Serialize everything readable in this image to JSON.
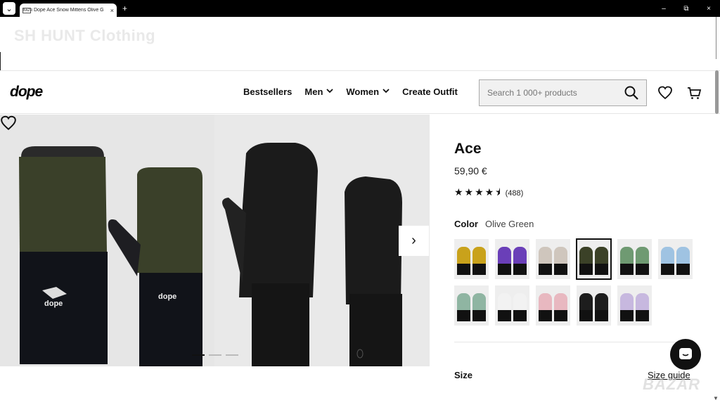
{
  "browser": {
    "tab_title": "Dope Ace Snow Mittens Olive G",
    "favicon_text": "BAZR",
    "new_tab": "+",
    "close_tab": "×",
    "minimize": "–",
    "maximize": "⧉",
    "close": "×"
  },
  "banner": {
    "store_name": "SH HUNT Clothing"
  },
  "header": {
    "logo": "dope",
    "nav": [
      {
        "label": "Bestsellers",
        "has_dropdown": false
      },
      {
        "label": "Men",
        "has_dropdown": true
      },
      {
        "label": "Women",
        "has_dropdown": true
      },
      {
        "label": "Create Outfit",
        "has_dropdown": false
      }
    ],
    "search_placeholder": "Search 1 000+ products",
    "icons": [
      "search-icon",
      "heart-icon",
      "cart-icon"
    ]
  },
  "gallery": {
    "image_count": 3,
    "active_index": 0,
    "next_icon": "›"
  },
  "product": {
    "name": "Ace",
    "price": "59,90 €",
    "rating_value": 4.5,
    "rating_stars": "★★★★⯨",
    "review_count": "(488)",
    "color_label": "Color",
    "color_value": "Olive Green",
    "swatches": [
      {
        "name": "Yellow",
        "color": "#c9a21b"
      },
      {
        "name": "Purple",
        "color": "#6a3fb8"
      },
      {
        "name": "Sand",
        "color": "#cfc6bd"
      },
      {
        "name": "Olive Green",
        "color": "#3b4127",
        "selected": true
      },
      {
        "name": "Green",
        "color": "#6f9a72"
      },
      {
        "name": "Light Blue",
        "color": "#9fc3e2"
      },
      {
        "name": "Mint",
        "color": "#8fb5a2"
      },
      {
        "name": "White",
        "color": "#f2f2f2"
      },
      {
        "name": "Pink",
        "color": "#e8b8c0"
      },
      {
        "name": "Black",
        "color": "#1d1d1d"
      },
      {
        "name": "Lavender",
        "color": "#c7b8df"
      }
    ],
    "size_label": "Size",
    "size_guide": "Size guide"
  },
  "watermark": "BAZAR"
}
